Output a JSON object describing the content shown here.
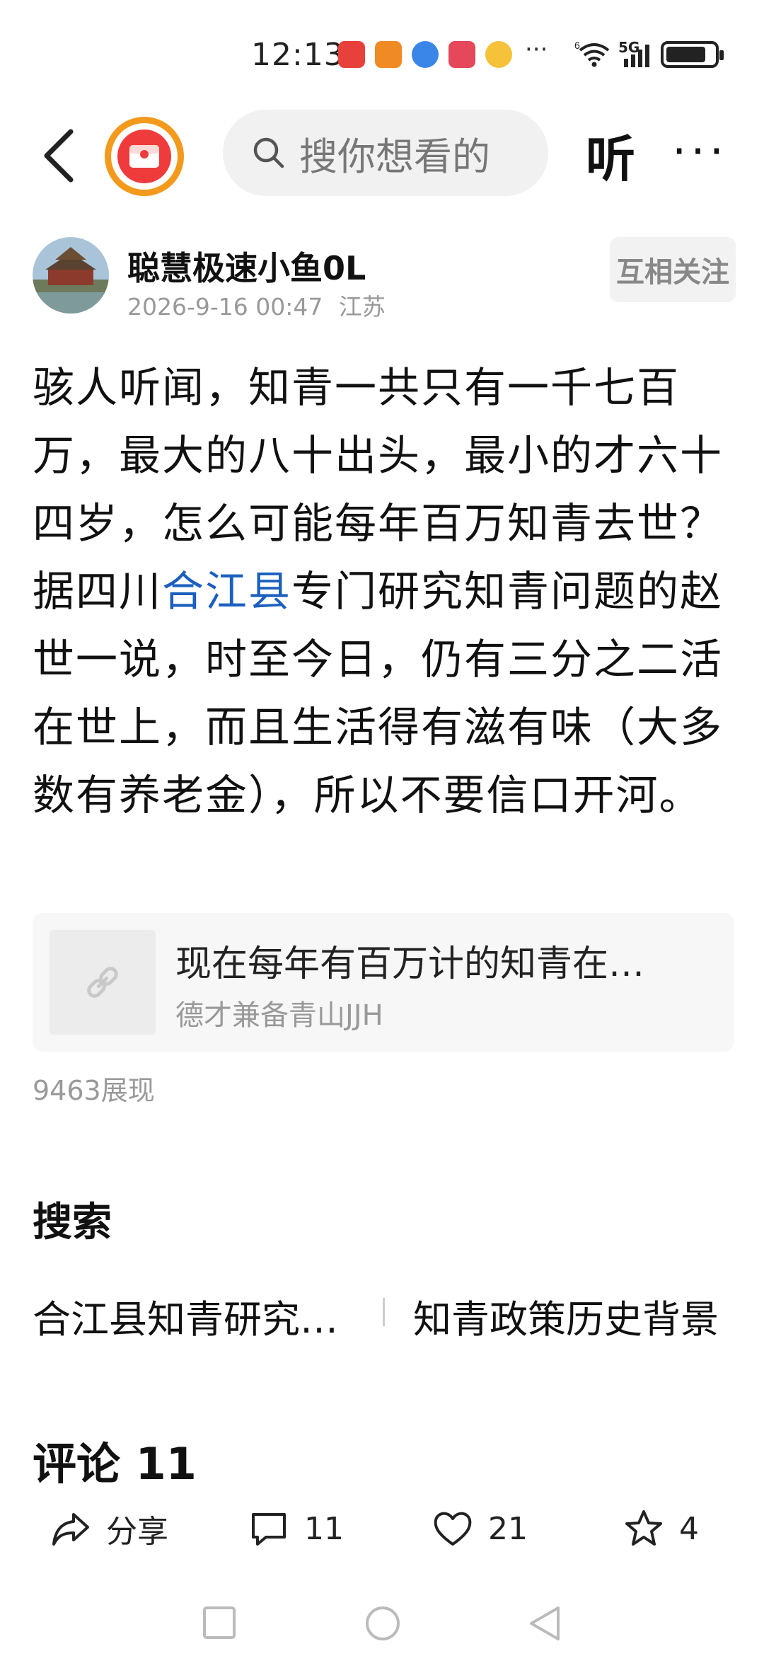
{
  "status_bar": {
    "time": "12:13",
    "network_top": "6",
    "network_5g": "5G",
    "more": "···",
    "battery_level": 0.85
  },
  "nav": {
    "search_placeholder": "搜你想看的",
    "listen_label": "听",
    "more_label": "···"
  },
  "author": {
    "name": "聪慧极速小鱼0L",
    "datetime": "2026-9-16 00:47",
    "location": "江苏",
    "follow_label": "互相关注"
  },
  "post": {
    "text_before": "骇人听闻，知青一共只有一千七百万，最大的八十出头，最小的才六十四岁，怎么可能每年百万知青去世？据四川",
    "link_text": "合江县",
    "text_after": "专门研究知青问题的赵世一说，时至今日，仍有三分之二活在世上，而且生活得有滋有味（大多数有养老金），所以不要信口开河。"
  },
  "quote": {
    "title": "现在每年有百万计的知青在…",
    "author": "德才兼备青山JJH"
  },
  "views": "9463展现",
  "search_section": {
    "title": "搜索",
    "suggestions": [
      "合江县知青研究…",
      "知青政策历史背景"
    ]
  },
  "comments": {
    "header": "评论 11"
  },
  "actions": {
    "share_label": "分享",
    "comment_count": "11",
    "like_count": "21",
    "favorite_count": "4"
  },
  "colors": {
    "link": "#1b5fbf",
    "logo_ring": "#f39a1d",
    "logo_red": "#ef3b3b"
  }
}
